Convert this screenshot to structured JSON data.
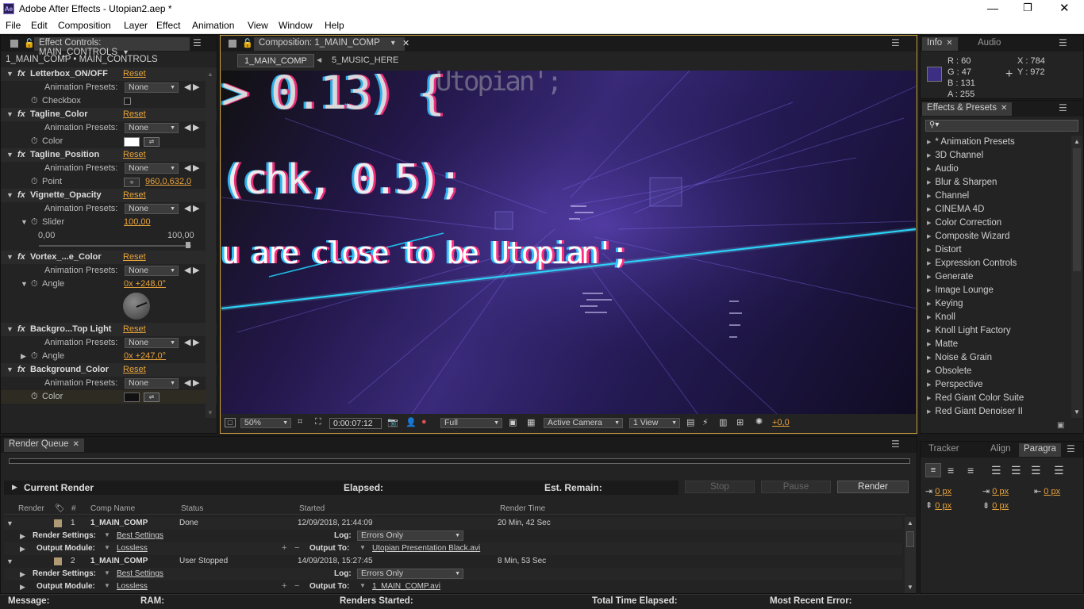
{
  "window": {
    "title": "Adobe After Effects - Utopian2.aep *",
    "app_icon": "Ae"
  },
  "menu": [
    "File",
    "Edit",
    "Composition",
    "Layer",
    "Effect",
    "Animation",
    "View",
    "Window",
    "Help"
  ],
  "effect_controls": {
    "tab": "Effect Controls: MAIN_CONTROLS",
    "layer_path": "1_MAIN_COMP • MAIN_CONTROLS",
    "reset": "Reset",
    "presets_label": "Animation Presets:",
    "presets_value": "None",
    "effects": [
      {
        "name": "Letterbox_ON/OFF",
        "param": "Checkbox"
      },
      {
        "name": "Tagline_Color",
        "param": "Color",
        "color": "#ffffff"
      },
      {
        "name": "Tagline_Position",
        "param": "Point",
        "value": "960,0,632,0"
      },
      {
        "name": "Vignette_Opacity",
        "param": "Slider",
        "value": "100,00",
        "min": "0,00",
        "max": "100,00"
      },
      {
        "name": "Vortex_...e_Color",
        "param": "Angle",
        "value": "0x +248,0°"
      },
      {
        "name": "Backgro...Top Light",
        "param": "Angle",
        "value": "0x +247,0°"
      },
      {
        "name": "Background_Color",
        "param": "Color",
        "color": "#111111"
      }
    ]
  },
  "composition": {
    "tab": "Composition: 1_MAIN_COMP",
    "breadcrumbs": [
      "1_MAIN_COMP",
      "5_MUSIC_HERE"
    ],
    "overlay": {
      "line1": "> 0.13) {",
      "line2": "(chk, 0.5);",
      "line3": "u are close to be Utopian';",
      "side": "Utopian';"
    },
    "toolbar": {
      "zoom": "50%",
      "timecode": "0:00:07:12",
      "resolution": "Full",
      "camera": "Active Camera",
      "views": "1 View",
      "exposure": "+0,0"
    }
  },
  "info": {
    "tabs": [
      "Info",
      "Audio"
    ],
    "r": "R : 60",
    "g": "G : 47",
    "b": "B : 131",
    "a": "A : 255",
    "x": "X : 784",
    "y": "Y : 972",
    "swatch": "#3c2f83"
  },
  "effects_presets": {
    "tab": "Effects & Presets",
    "items": [
      "* Animation Presets",
      "3D Channel",
      "Audio",
      "Blur & Sharpen",
      "Channel",
      "CINEMA 4D",
      "Color Correction",
      "Composite Wizard",
      "Distort",
      "Expression Controls",
      "Generate",
      "Image Lounge",
      "Keying",
      "Knoll",
      "Knoll Light Factory",
      "Matte",
      "Noise & Grain",
      "Obsolete",
      "Perspective",
      "Red Giant Color Suite",
      "Red Giant Denoiser II"
    ]
  },
  "render_queue": {
    "tab": "Render Queue",
    "current_render": "Current Render",
    "elapsed": "Elapsed:",
    "remain": "Est. Remain:",
    "buttons": {
      "stop": "Stop",
      "pause": "Pause",
      "render": "Render"
    },
    "columns": [
      "Render",
      "#",
      "Comp Name",
      "Status",
      "Started",
      "Render Time"
    ],
    "render_settings_label": "Render Settings:",
    "output_module_label": "Output Module:",
    "log_label": "Log:",
    "output_to_label": "Output To:",
    "items": [
      {
        "num": "1",
        "comp": "1_MAIN_COMP",
        "status": "Done",
        "started": "12/09/2018, 21:44:09",
        "time": "20 Min, 42 Sec",
        "settings": "Best Settings",
        "log": "Errors Only",
        "module": "Lossless",
        "output": "Utopian Presentation Black.avi"
      },
      {
        "num": "2",
        "comp": "1_MAIN_COMP",
        "status": "User Stopped",
        "started": "14/09/2018, 15:27:45",
        "time": "8 Min, 53 Sec",
        "settings": "Best Settings",
        "log": "Errors Only",
        "module": "Lossless",
        "output": "1_MAIN_COMP.avi"
      }
    ]
  },
  "paragraph": {
    "tabs": [
      "Tracker",
      "Align",
      "Paragra"
    ],
    "px": "0 px"
  },
  "status": {
    "message": "Message:",
    "ram": "RAM:",
    "renders": "Renders Started:",
    "total": "Total Time Elapsed:",
    "error": "Most Recent Error:"
  }
}
